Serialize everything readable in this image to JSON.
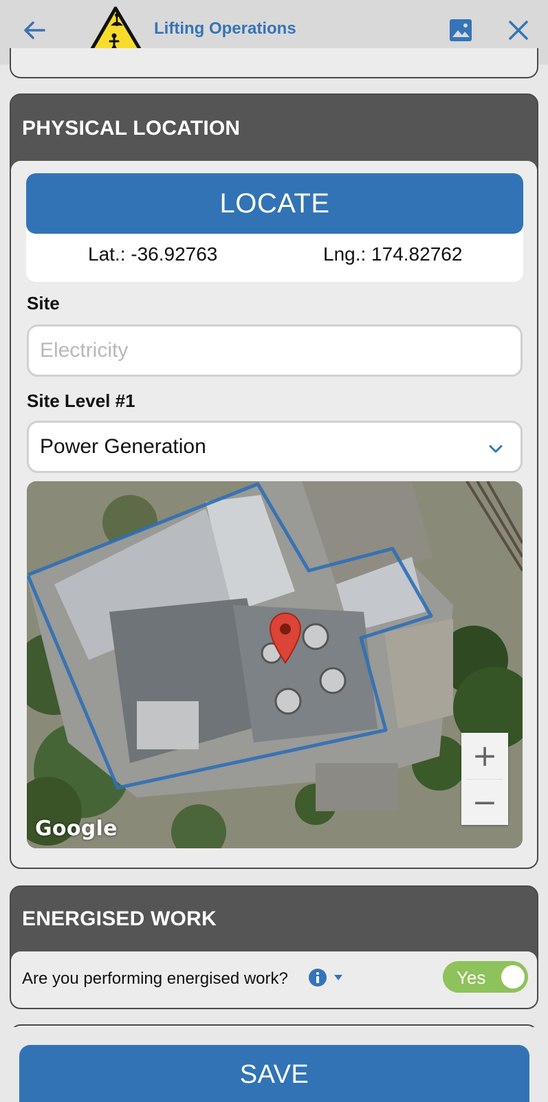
{
  "header": {
    "title": "Lifting Operations",
    "icons": {
      "back": "arrow-left-icon",
      "logo": "lifting-warning-icon",
      "image": "image-icon",
      "close": "close-icon"
    },
    "accent_color": "#3574b8"
  },
  "physical_location": {
    "heading": "PHYSICAL LOCATION",
    "locate_label": "LOCATE",
    "lat_text": "Lat.: -36.92763",
    "lng_text": "Lng.: 174.82762",
    "site_label": "Site",
    "site_placeholder": "Electricity",
    "site_level_label": "Site Level #1",
    "site_level_value": "Power Generation",
    "map": {
      "attribution": "Google",
      "zoom_in": "+",
      "zoom_out": "−",
      "marker_color": "#db4437",
      "boundary_color": "#2f6fb5"
    }
  },
  "energised_work": {
    "heading": "ENERGISED WORK",
    "question": "Are you performing energised work?",
    "toggle_label": "Yes",
    "toggle_on": true,
    "toggle_color": "#8ec25a"
  },
  "footer": {
    "save_label": "SAVE",
    "button_color": "#3273b6"
  }
}
